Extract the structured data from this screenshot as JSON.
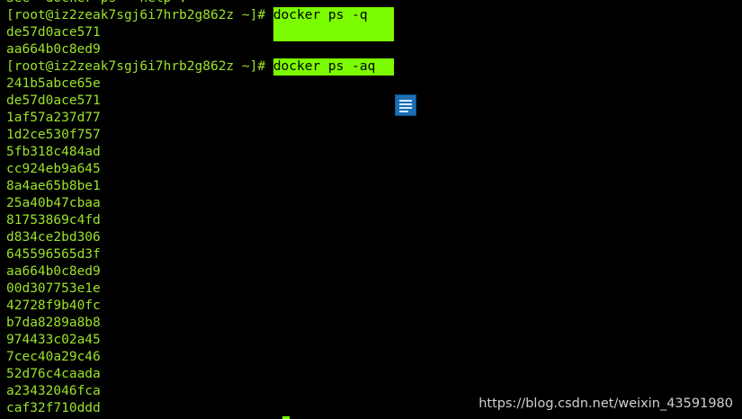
{
  "terminal": {
    "top_partial": "See 'docker ps --help'.",
    "prompt1": "[root@iz2zeak7sgj6i7hrb2g862z ~]#",
    "command1": " docker ps -q",
    "output1": [
      "de57d0ace571",
      "aa664b0c8ed9"
    ],
    "prompt2": "[root@iz2zeak7sgj6i7hrb2g862z ~]#",
    "command2": " docker ps -aq",
    "output2": [
      "241b5abce65e",
      "de57d0ace571",
      "1af57a237d77",
      "1d2ce530f757",
      "5fb318c484ad",
      "cc924eb9a645",
      "8a4ae65b8be1",
      "25a40b47cbaa",
      "81753869c4fd",
      "d834ce2bd306",
      "645596565d3f",
      "aa664b0c8ed9",
      "00d307753e1e",
      "42728f9b40fc",
      "b7da8289a8b8",
      "974433c02a45",
      "7cec40a29c46",
      "52d76c4caada",
      "a23432046fca",
      "caf32f710ddd"
    ]
  },
  "watermark": "https://blog.csdn.net/weixin_43591980",
  "colors": {
    "background": "#000000",
    "text": "#9be22a",
    "highlight": "#7cfc00",
    "icon": "#1b6fb5"
  },
  "icons": {
    "floating": "document-icon"
  }
}
